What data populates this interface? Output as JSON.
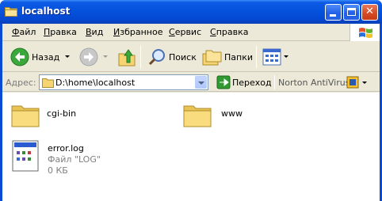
{
  "window": {
    "title": "localhost"
  },
  "menu": {
    "items": [
      {
        "label": "Файл"
      },
      {
        "label": "Правка"
      },
      {
        "label": "Вид"
      },
      {
        "label": "Избранное"
      },
      {
        "label": "Сервис"
      },
      {
        "label": "Справка"
      }
    ]
  },
  "toolbar": {
    "back_label": "Назад",
    "search_label": "Поиск",
    "folders_label": "Папки"
  },
  "address": {
    "label": "Адрес:",
    "value": "D:\\home\\localhost",
    "go_label": "Переход",
    "plugin_label": "Norton AntiVirus"
  },
  "files": [
    {
      "name": "cgi-bin",
      "type": "folder"
    },
    {
      "name": "www",
      "type": "folder"
    },
    {
      "name": "error.log",
      "type_label": "Файл \"LOG\"",
      "size": "0 КБ"
    }
  ],
  "colors": {
    "titlebar": "#0453dc",
    "chrome": "#ece9d8",
    "folder": "#f5d573",
    "go_green": "#2f9a2f"
  }
}
